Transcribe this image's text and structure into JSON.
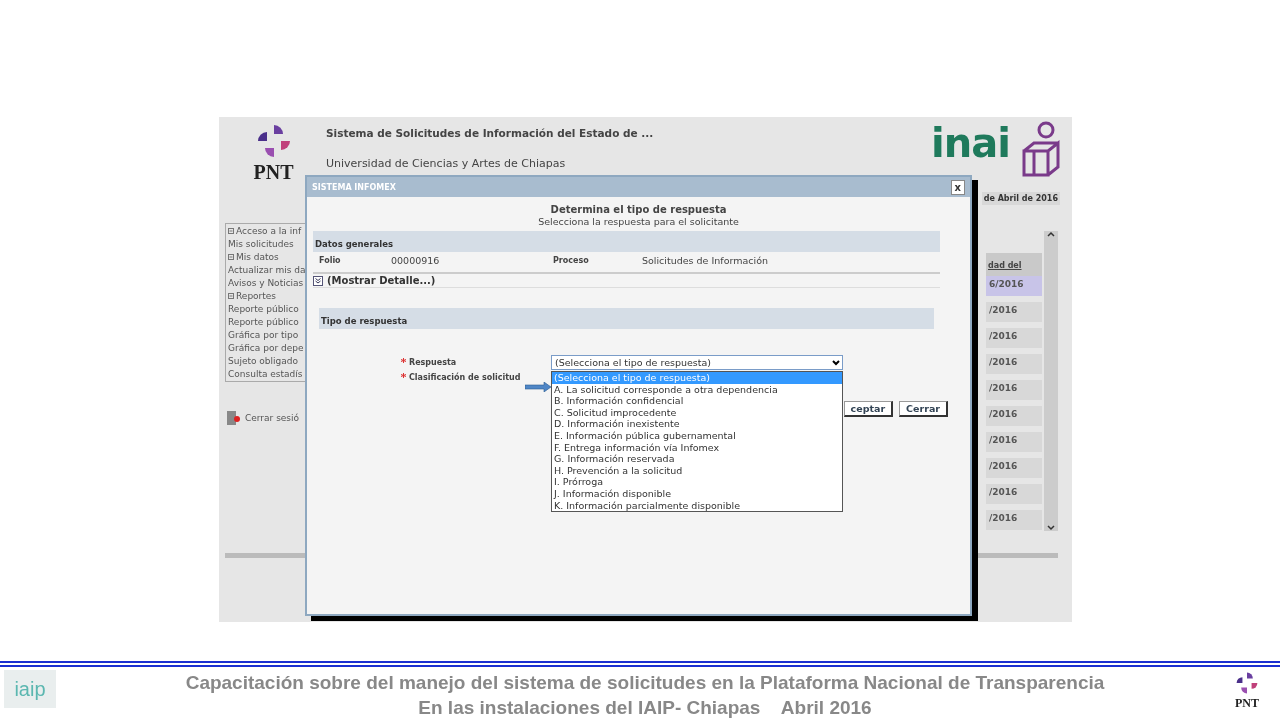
{
  "page": {
    "logo": "PNT",
    "brand": "inai",
    "title": "Sistema de Solicitudes de Información del Estado de ...",
    "subtitle": "Universidad de Ciencias y Artes de Chiapas",
    "date": "de Abril de 2016"
  },
  "sidebar": {
    "items": [
      {
        "label": "Acceso a la inf",
        "kind": "group"
      },
      {
        "label": "Mis solicitudes",
        "kind": "link"
      },
      {
        "label": "Mis datos",
        "kind": "group"
      },
      {
        "label": "Actualizar mis da",
        "kind": "link"
      },
      {
        "label": "Avisos y Noticias",
        "kind": "link"
      },
      {
        "label": "Reportes",
        "kind": "group"
      },
      {
        "label": "Reporte público",
        "kind": "link"
      },
      {
        "label": "Reporte público",
        "kind": "link"
      },
      {
        "label": "Gráfica por tipo",
        "kind": "link"
      },
      {
        "label": "Gráfica por depe",
        "kind": "link"
      },
      {
        "label": "Sujeto obligado",
        "kind": "link"
      },
      {
        "label": "Consulta estadís",
        "kind": "link"
      }
    ],
    "logout": "Cerrar sesió"
  },
  "table": {
    "column": "dad del",
    "rows": [
      {
        "text": "6/2016",
        "selected": true
      },
      {
        "text": "/2016",
        "selected": false
      },
      {
        "text": "/2016",
        "selected": false
      },
      {
        "text": "/2016",
        "selected": false
      },
      {
        "text": "/2016",
        "selected": false
      },
      {
        "text": "/2016",
        "selected": false
      },
      {
        "text": "/2016",
        "selected": false
      },
      {
        "text": "/2016",
        "selected": false
      },
      {
        "text": "/2016",
        "selected": false
      },
      {
        "text": "/2016",
        "selected": false
      }
    ]
  },
  "dialog": {
    "title": "SISTEMA INFOMEX",
    "close": "x",
    "heading": "Determina el tipo de respuesta",
    "subheading": "Selecciona la respuesta para el solicitante",
    "general": {
      "title": "Datos generales",
      "fields": [
        {
          "label": "Folio",
          "value": "00000916"
        },
        {
          "label": "Proceso",
          "value": "Solicitudes de Información"
        }
      ],
      "toggle": "(Mostrar Detalle...)"
    },
    "section": "Tipo de respuesta",
    "form": {
      "fields": [
        {
          "label": "Respuesta",
          "required": true
        },
        {
          "label": "Clasificación de solicitud",
          "required": true
        }
      ],
      "select": {
        "value": "(Selecciona el tipo de respuesta)",
        "expanded": true,
        "options": [
          {
            "label": "(Selecciona el tipo de respuesta)",
            "selected": true
          },
          {
            "label": "A. La solicitud corresponde a otra dependencia",
            "selected": false
          },
          {
            "label": "B. Información confidencial",
            "selected": false
          },
          {
            "label": "C. Solicitud improcedente",
            "selected": false
          },
          {
            "label": "D. Información inexistente",
            "selected": false
          },
          {
            "label": "E. Información pública gubernamental",
            "selected": false
          },
          {
            "label": "F. Entrega información vía Infomex",
            "selected": false
          },
          {
            "label": "G. Información reservada",
            "selected": false
          },
          {
            "label": "H. Prevención a la solicitud",
            "selected": false
          },
          {
            "label": "I. Prórroga",
            "selected": false
          },
          {
            "label": "J. Información disponible",
            "selected": false
          },
          {
            "label": "K. Información parcialmente disponible",
            "selected": false
          }
        ]
      }
    },
    "buttons": [
      "ceptar",
      "Cerrar"
    ]
  },
  "footer": {
    "lines": [
      "Capacitación sobre del manejo del sistema de solicitudes en la Plataforma Nacional de Transparencia",
      "En las instalaciones del IAIP- Chiapas    Abril 2016"
    ],
    "left_logo": "iaip",
    "right_logo": "PNT"
  }
}
